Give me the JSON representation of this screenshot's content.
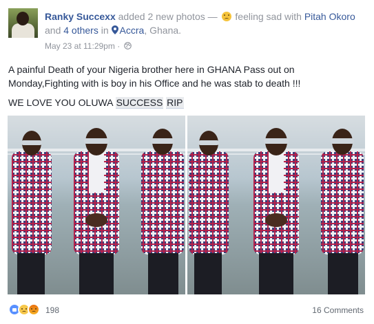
{
  "post": {
    "author": "Ranky Succexx",
    "action": "added 2 new photos —",
    "feeling": "feeling sad with",
    "tagged_person": "Pitah Okoro",
    "and_text": "and",
    "others": "4 others",
    "in_text": "in",
    "location_city": "Accra",
    "location_rest": ", Ghana.",
    "date": "May 23 at 11:29pm",
    "separator": "·",
    "icons": {
      "feeling": "sad-face-icon",
      "location": "map-pin-icon",
      "privacy": "globe-icon"
    },
    "text_line1": "A painful Death of your Nigeria brother here in GHANA Pass out on Monday,Fighting with is boy in his Office and he was stab to death !!!",
    "text_line2_prefix": "WE LOVE YOU OLUWA ",
    "text_line2_tag1": "SUCCESS",
    "text_line2_space": " ",
    "text_line2_tag2": "RIP"
  },
  "footer": {
    "reaction_icons": [
      "like-icon",
      "sad-reaction-icon",
      "angry-reaction-icon"
    ],
    "reaction_count": "198",
    "comments": "16 Comments"
  },
  "colors": {
    "link": "#365899",
    "muted": "#90949c",
    "text": "#1d2129",
    "like": "#5890ff"
  }
}
